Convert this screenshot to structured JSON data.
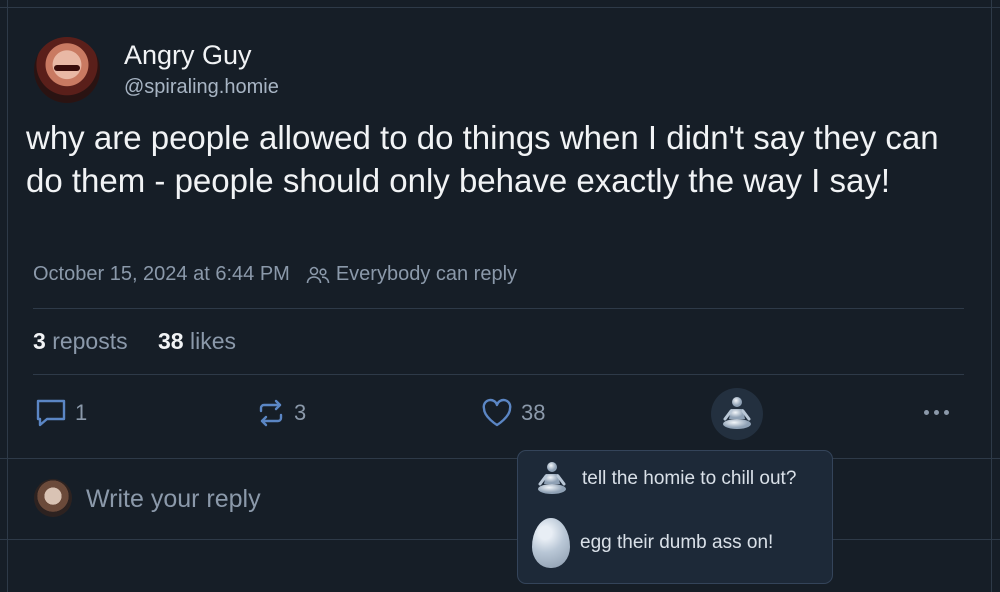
{
  "author": {
    "name": "Angry Guy",
    "handle": "@spiraling.homie"
  },
  "post": {
    "text": "why are people allowed to do things when I didn't say they can do them - people should only behave exactly the way I say!",
    "timestamp": "October 15, 2024 at 6:44 PM",
    "reply_setting": "Everybody can reply"
  },
  "stats": {
    "reposts_count": "3",
    "reposts_label": "reposts",
    "likes_count": "38",
    "likes_label": "likes"
  },
  "actions": {
    "reply_count": "1",
    "repost_count": "3",
    "like_count": "38"
  },
  "reply_box": {
    "placeholder": "Write your reply"
  },
  "popover": {
    "items": [
      {
        "label": "tell the homie to chill out?",
        "icon": "meditating-figure-icon"
      },
      {
        "label": "egg their dumb ass on!",
        "icon": "egg-icon"
      }
    ]
  },
  "colors": {
    "background": "#161e27",
    "text_primary": "#f1f3f5",
    "text_muted": "#8b99aa",
    "divider": "#2e3a48",
    "popover_bg": "#1d2938"
  }
}
